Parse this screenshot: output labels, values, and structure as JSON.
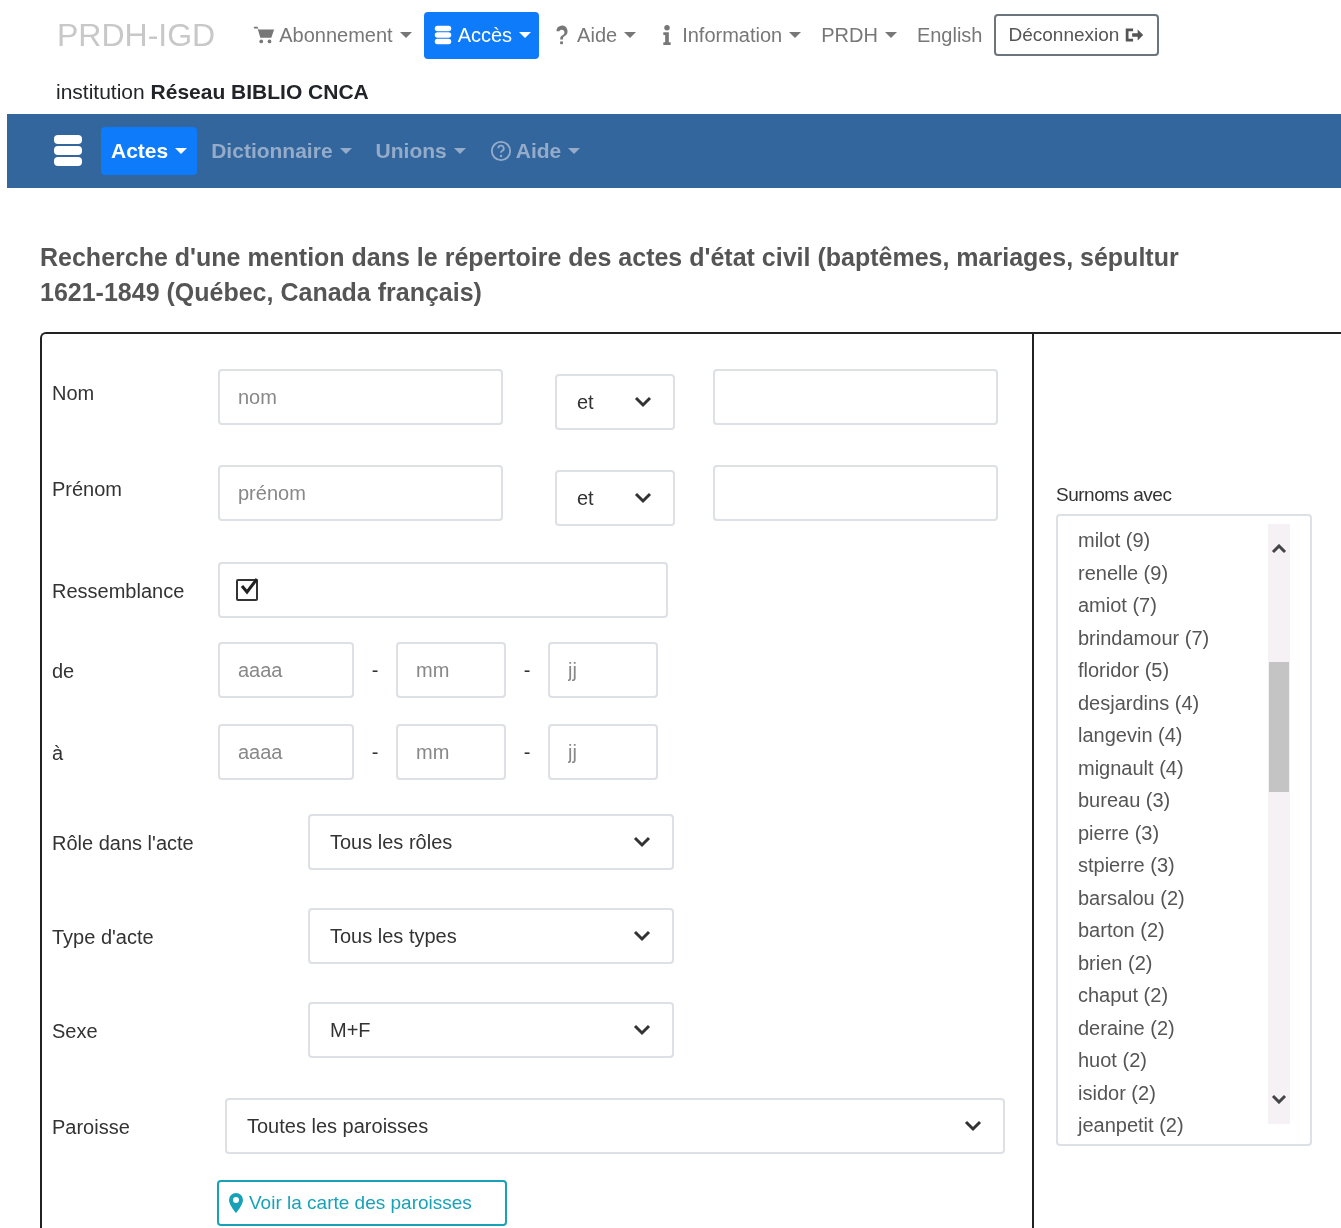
{
  "top_nav": {
    "brand": "PRDH-IGD",
    "items": [
      {
        "label": "Abonnement",
        "dropdown": true,
        "selected": false
      },
      {
        "label": "Accès",
        "dropdown": true,
        "selected": true
      },
      {
        "label": "Aide",
        "dropdown": true,
        "selected": false
      },
      {
        "label": "Information",
        "dropdown": true,
        "selected": false
      },
      {
        "label": "PRDH",
        "dropdown": true,
        "selected": false
      },
      {
        "label": "English",
        "dropdown": false,
        "selected": false
      }
    ],
    "logout_button": {
      "label": "Déconnexion"
    }
  },
  "institution": {
    "prefix": "institution",
    "name": "Réseau BIBLIO CNCA"
  },
  "sub_nav": {
    "items": [
      {
        "label": "Actes",
        "dropdown": true,
        "selected": true
      },
      {
        "label": "Dictionnaire",
        "dropdown": true,
        "selected": false
      },
      {
        "label": "Unions",
        "dropdown": true,
        "selected": false
      },
      {
        "label": "Aide",
        "dropdown": true,
        "selected": false
      }
    ]
  },
  "heading": [
    "Recherche d'une mention dans le répertoire des actes d'état civil (baptêmes, mariages, sépultur",
    "1621-1849 (Québec, Canada français)"
  ],
  "form": {
    "rows": [
      {
        "kind": "text-pair",
        "label": "Nom",
        "placeholder": "nom",
        "operator": "et"
      },
      {
        "kind": "text-pair",
        "label": "Prénom",
        "placeholder": "prénom",
        "operator": "et"
      },
      {
        "kind": "checkbox",
        "label": "Ressemblance",
        "checked": true
      },
      {
        "kind": "date",
        "label": "de",
        "placeholders": [
          "aaaa",
          "mm",
          "jj"
        ],
        "separators": [
          "-",
          "-"
        ]
      },
      {
        "kind": "date",
        "label": "à",
        "placeholders": [
          "aaaa",
          "mm",
          "jj"
        ],
        "separators": [
          "-",
          "-"
        ]
      },
      {
        "kind": "select",
        "label": "Rôle dans l'acte",
        "value": "Tous les rôles"
      },
      {
        "kind": "select",
        "label": "Type d'acte",
        "value": "Tous les types"
      },
      {
        "kind": "select",
        "label": "Sexe",
        "value": "M+F"
      },
      {
        "kind": "select-wide",
        "label": "Paroisse",
        "value": "Toutes les paroisses"
      }
    ],
    "map_button": {
      "label": "Voir la carte des paroisses"
    }
  },
  "surnames": {
    "label": "Surnoms avec",
    "items": [
      "milot (9)",
      "renelle (9)",
      "amiot (7)",
      "brindamour (7)",
      "floridor (5)",
      "desjardins (4)",
      "langevin (4)",
      "mignault (4)",
      "bureau (3)",
      "pierre (3)",
      "stpierre (3)",
      "barsalou (2)",
      "barton (2)",
      "brien (2)",
      "chaput (2)",
      "deraine (2)",
      "huot (2)",
      "isidor (2)",
      "jeanpetit (2)"
    ]
  }
}
